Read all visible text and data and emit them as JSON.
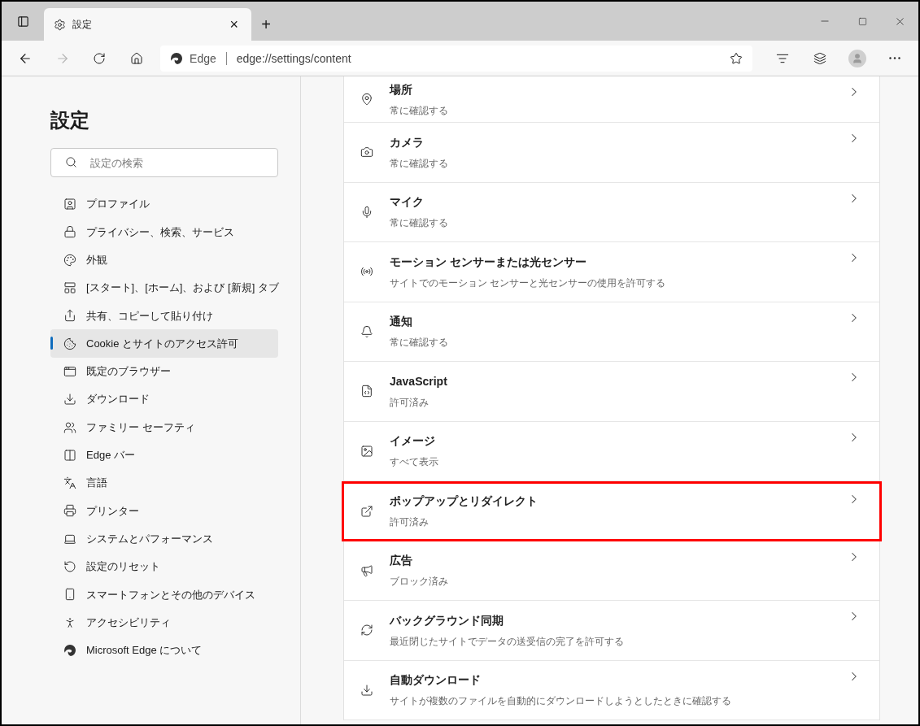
{
  "tab": {
    "title": "設定",
    "close": "×",
    "new_tab": "+"
  },
  "address_bar": {
    "site_label": "Edge",
    "url": "edge://settings/content"
  },
  "sidebar": {
    "title": "設定",
    "search": {
      "placeholder": "設定の検索"
    },
    "items": [
      {
        "label": "プロファイル",
        "selected": false
      },
      {
        "label": "プライバシー、検索、サービス",
        "selected": false
      },
      {
        "label": "外観",
        "selected": false
      },
      {
        "label": "[スタート]、[ホーム]、および [新規] タブ",
        "selected": false
      },
      {
        "label": "共有、コピーして貼り付け",
        "selected": false
      },
      {
        "label": "Cookie とサイトのアクセス許可",
        "selected": true
      },
      {
        "label": "既定のブラウザー",
        "selected": false
      },
      {
        "label": "ダウンロード",
        "selected": false
      },
      {
        "label": "ファミリー セーフティ",
        "selected": false
      },
      {
        "label": "Edge バー",
        "selected": false
      },
      {
        "label": "言語",
        "selected": false
      },
      {
        "label": "プリンター",
        "selected": false
      },
      {
        "label": "システムとパフォーマンス",
        "selected": false
      },
      {
        "label": "設定のリセット",
        "selected": false
      },
      {
        "label": "スマートフォンとその他のデバイス",
        "selected": false
      },
      {
        "label": "アクセシビリティ",
        "selected": false
      },
      {
        "label": "Microsoft Edge について",
        "selected": false
      }
    ]
  },
  "permissions": [
    {
      "title": "場所",
      "subtitle": "常に確認する",
      "highlighted": false
    },
    {
      "title": "カメラ",
      "subtitle": "常に確認する",
      "highlighted": false
    },
    {
      "title": "マイク",
      "subtitle": "常に確認する",
      "highlighted": false
    },
    {
      "title": "モーション センサーまたは光センサー",
      "subtitle": "サイトでのモーション センサーと光センサーの使用を許可する",
      "highlighted": false
    },
    {
      "title": "通知",
      "subtitle": "常に確認する",
      "highlighted": false
    },
    {
      "title": "JavaScript",
      "subtitle": "許可済み",
      "highlighted": false
    },
    {
      "title": "イメージ",
      "subtitle": "すべて表示",
      "highlighted": false
    },
    {
      "title": "ポップアップとリダイレクト",
      "subtitle": "許可済み",
      "highlighted": true
    },
    {
      "title": "広告",
      "subtitle": "ブロック済み",
      "highlighted": false
    },
    {
      "title": "バックグラウンド同期",
      "subtitle": "最近閉じたサイトでデータの送受信の完了を許可する",
      "highlighted": false
    },
    {
      "title": "自動ダウンロード",
      "subtitle": "サイトが複数のファイルを自動的にダウンロードしようとしたときに確認する",
      "highlighted": false
    }
  ]
}
